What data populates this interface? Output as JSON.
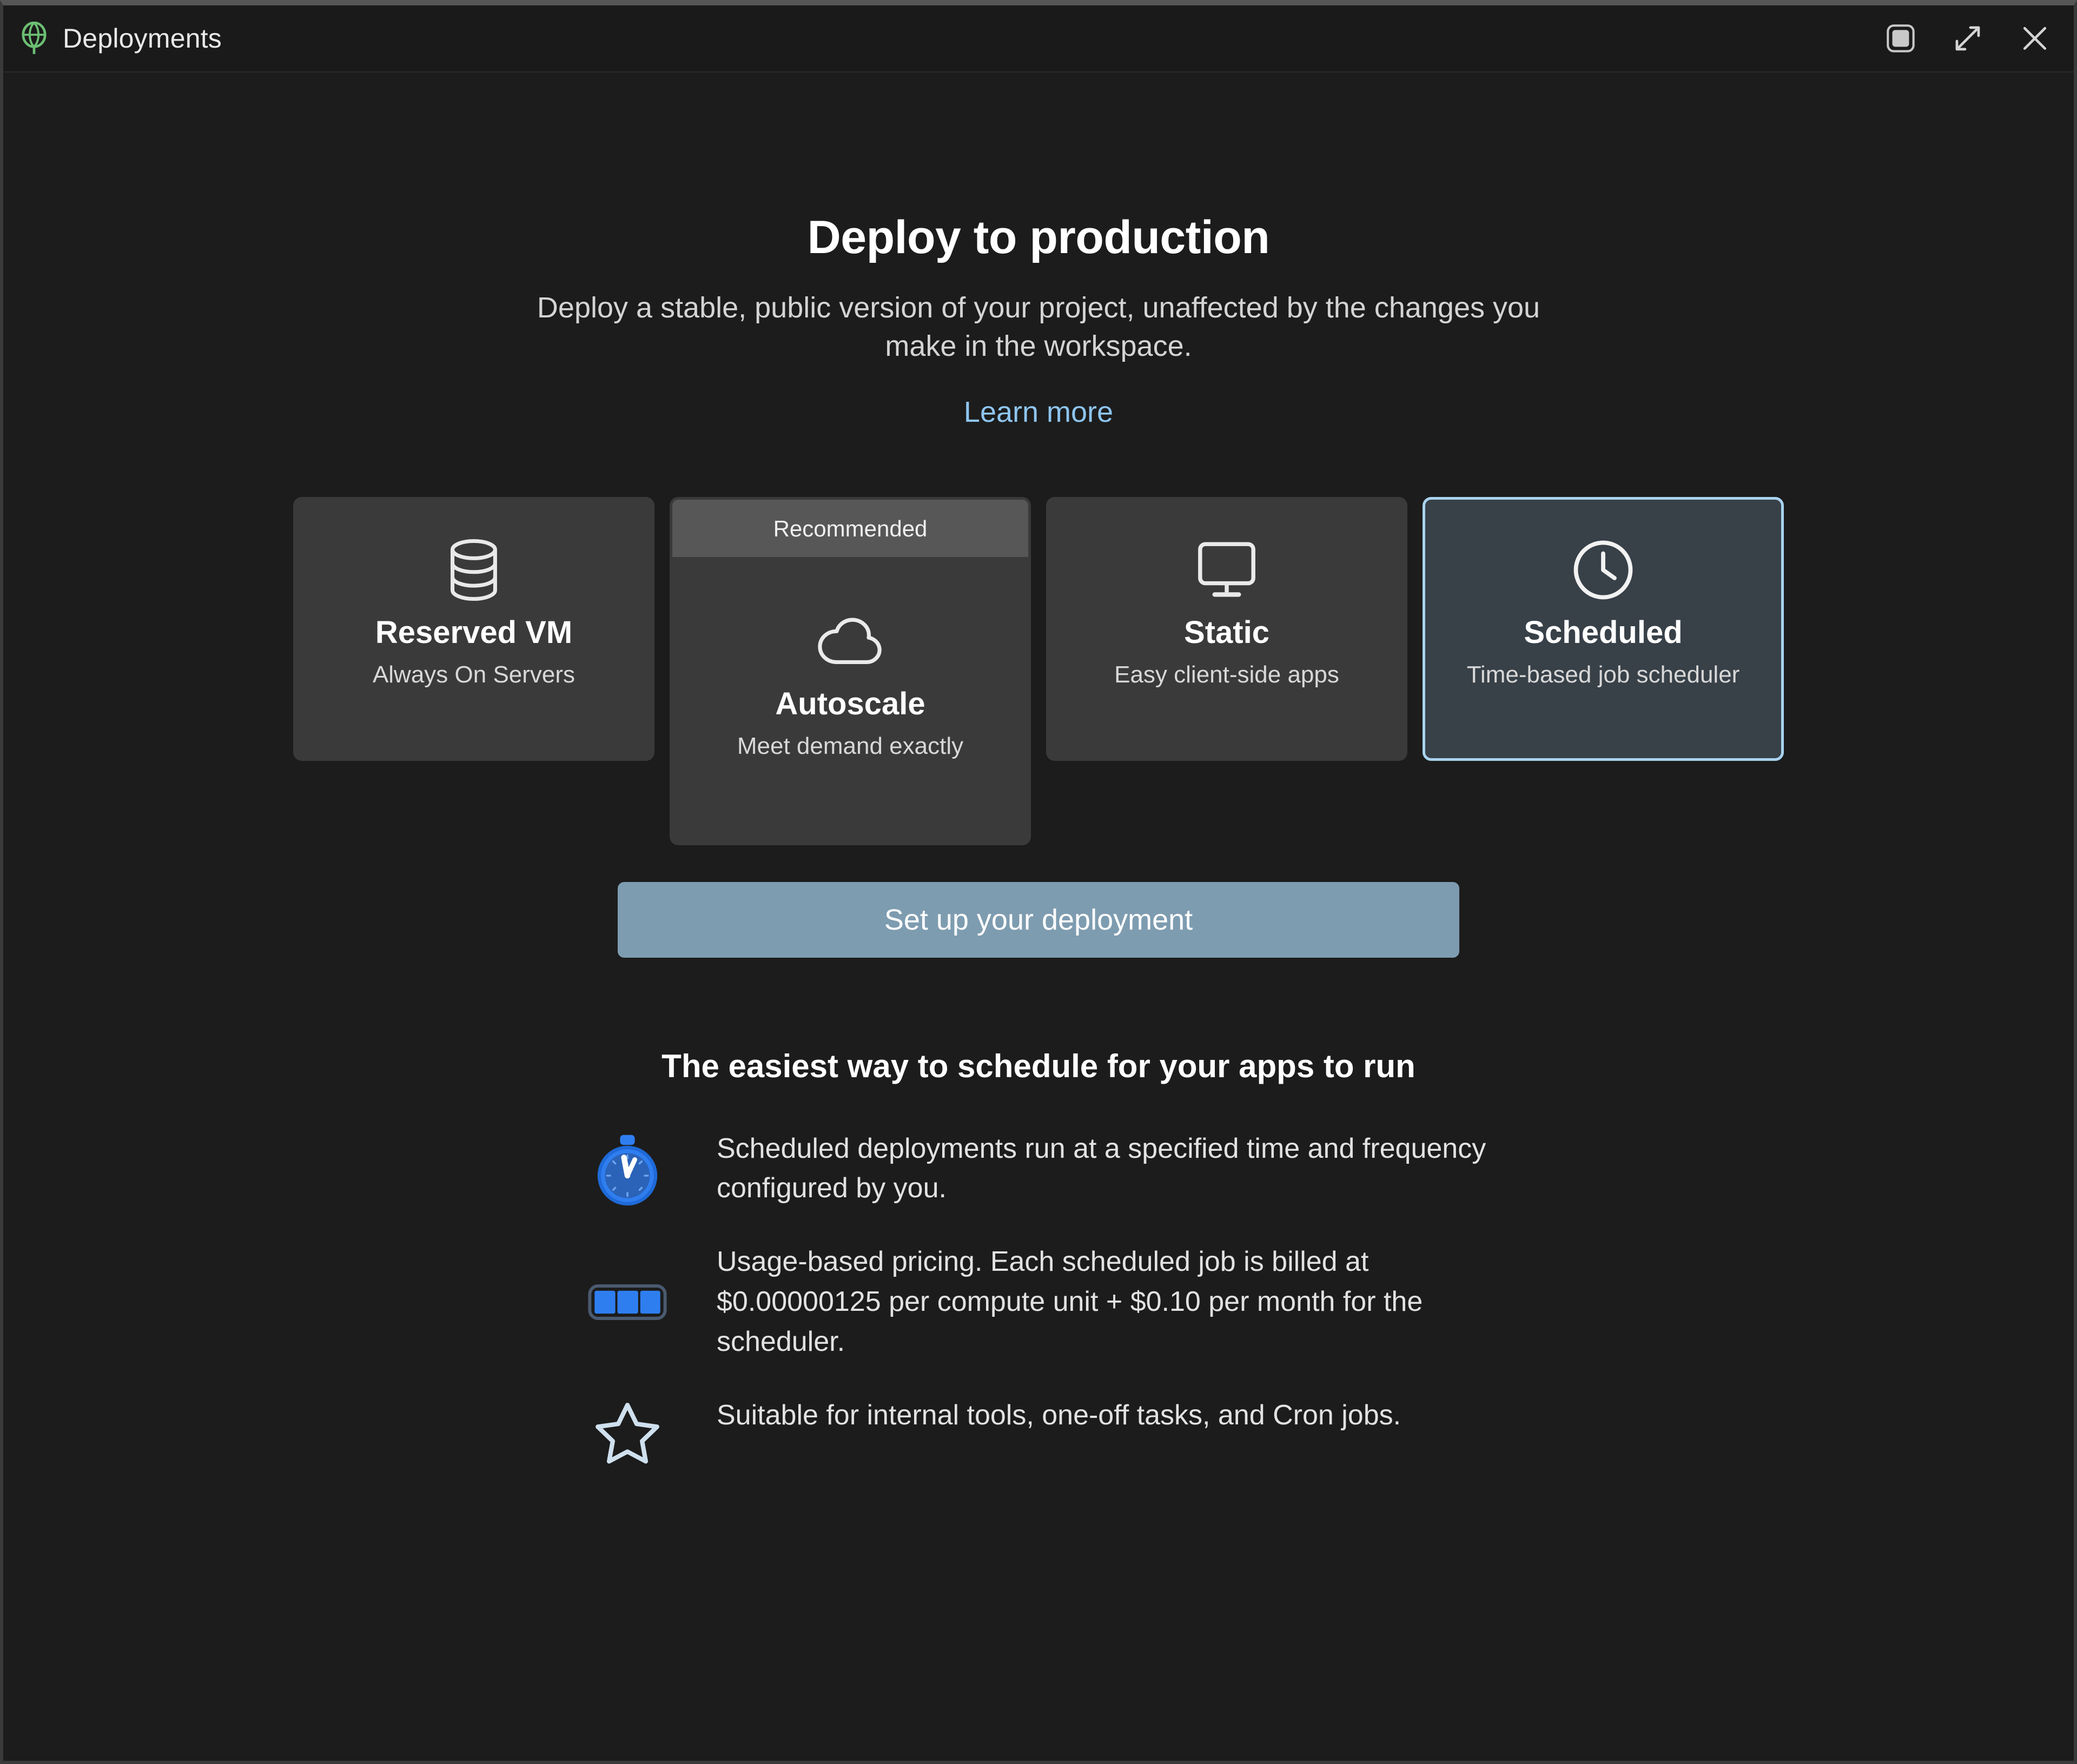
{
  "window": {
    "title": "Deployments",
    "app_icon": "balloon-icon",
    "controls": [
      {
        "name": "panel-toggle-icon",
        "label": "Panel"
      },
      {
        "name": "expand-icon",
        "label": "Expand"
      },
      {
        "name": "close-icon",
        "label": "Close"
      }
    ]
  },
  "hero": {
    "title": "Deploy to production",
    "subtitle": "Deploy a stable, public version of your project, unaffected by the changes you make in the workspace.",
    "link_label": "Learn more"
  },
  "options": [
    {
      "id": "reserved-vm",
      "icon": "database-icon",
      "title": "Reserved VM",
      "description": "Always On Servers",
      "badge": null,
      "selected": false
    },
    {
      "id": "autoscale",
      "icon": "cloud-icon",
      "title": "Autoscale",
      "description": "Meet demand exactly",
      "badge": "Recommended",
      "selected": false
    },
    {
      "id": "static",
      "icon": "monitor-icon",
      "title": "Static",
      "description": "Easy client-side apps",
      "badge": null,
      "selected": false
    },
    {
      "id": "scheduled",
      "icon": "clock-icon",
      "title": "Scheduled",
      "description": "Time-based job scheduler",
      "badge": null,
      "selected": true
    }
  ],
  "cta": {
    "label": "Set up your deployment"
  },
  "features": {
    "heading": "The easiest way to schedule for your apps to run",
    "items": [
      {
        "icon": "stopwatch-icon",
        "text": "Scheduled deployments run at a specified time and frequency configured by you."
      },
      {
        "icon": "usage-bars-icon",
        "text": "Usage-based pricing. Each scheduled job is billed at $0.00000125 per compute unit + $0.10 per month for the scheduler."
      },
      {
        "icon": "star-icon",
        "text": "Suitable for internal tools, one-off tasks, and Cron jobs."
      }
    ]
  },
  "colors": {
    "window_background": "#1c1c1c",
    "card_background": "#3a3a3a",
    "selected_card_background": "#384048",
    "selected_card_border": "#a9d3ef",
    "badge_background": "#575757",
    "cta_background": "#7e9cb0",
    "link": "#8ec5f0",
    "accent_blue": "#2f7ef0",
    "app_icon_green": "#6bbf73"
  }
}
